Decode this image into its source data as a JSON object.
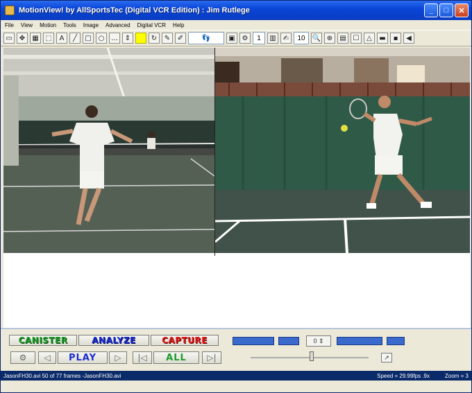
{
  "window": {
    "title": "MotionView! by AllSportsTec (Digital VCR Edition) : Jim Rutlege"
  },
  "menu": [
    "File",
    "View",
    "Motion",
    "Tools",
    "Image",
    "Advanced",
    "Digital VCR",
    "Help"
  ],
  "toolbar": {
    "frame_step_value": "1",
    "zoom_value": "10"
  },
  "modes": {
    "canister": "CANISTER",
    "analyze": "ANALYZE",
    "capture": "CAPTURE"
  },
  "controls": {
    "play": "PLAY",
    "all": "ALL",
    "speed_selector": "0"
  },
  "status": {
    "left": "JasonFH30.avi    50 of 77 frames  -JasonFH30.avi",
    "speed": "Speed = 29.99fps  .9x",
    "zoom": "Zoom = 3"
  },
  "colors": {
    "titlebar": "#0a46d8",
    "statusbar": "#0a2a6a",
    "canister": "#1a9a2a",
    "analyze": "#1a2ad0",
    "capture": "#e01818"
  }
}
